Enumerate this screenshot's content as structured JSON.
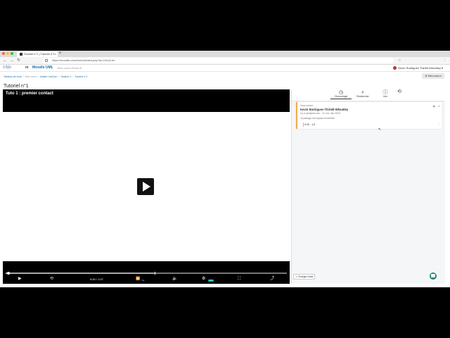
{
  "browser": {
    "tab_title": "Tutoriel n°1 | Tutoriel n°1",
    "tab_close": "×",
    "new_tab": "+",
    "url": "https://moodle.univ/mod/url/view.php?id=1941&.fm",
    "nav_back": "←",
    "nav_forward": "→",
    "nav_reload": "↻",
    "ext_icons": [
      "☆",
      "⋮"
    ]
  },
  "moodle": {
    "logo_text": "Ubfo",
    "app_mark": "m",
    "site_name": "Moodle UML",
    "nav_muted": "Mes cours  Privés ▾",
    "user_name": "Kevin Rodrigues Thirtell-Wheatley ▾"
  },
  "breadcrumb": {
    "items": [
      "Tableau de bord",
      "Mes cours",
      "Atelier UniCom",
      "Section 1",
      "Tutoriel n°1"
    ],
    "sep": "/"
  },
  "actions_button": "⚙ Mes cours ▾",
  "page_title": "Tutoriel n°1",
  "player": {
    "video_title": "Tuto 1 : premier contact",
    "time": "0:00 / 1:07",
    "speed": "1×",
    "progress": 0.53,
    "hd_badge": "HD",
    "icons": {
      "play": "▶",
      "rewind": "⟲",
      "speed": "⏩",
      "volume": "🔈",
      "settings": "⚙",
      "fullscreen": "⛶",
      "share": "⤴"
    }
  },
  "panel": {
    "tabs": [
      {
        "icon": "◷",
        "label": "Chronologie"
      },
      {
        "icon": "⌕",
        "label": "Rechercher"
      },
      {
        "icon": "ⓘ",
        "label": "Info"
      }
    ],
    "refresh_icon": "⟲",
    "card": {
      "label": "Vous suivez",
      "name": "Kevin Rodrigues Thirtell-Wheatley",
      "meta": "Il y a quelques sec · 12 nov. déc 2023",
      "note": "Je partage cet espace ensemble",
      "timecode": "0:00 - 1:5",
      "hide_icon": "◉",
      "share_icon": "⋖",
      "drag_icon": "⋮",
      "menu_icon": "⋮"
    },
    "change_mode": "☺ Changer mode"
  },
  "cursor": "↖"
}
